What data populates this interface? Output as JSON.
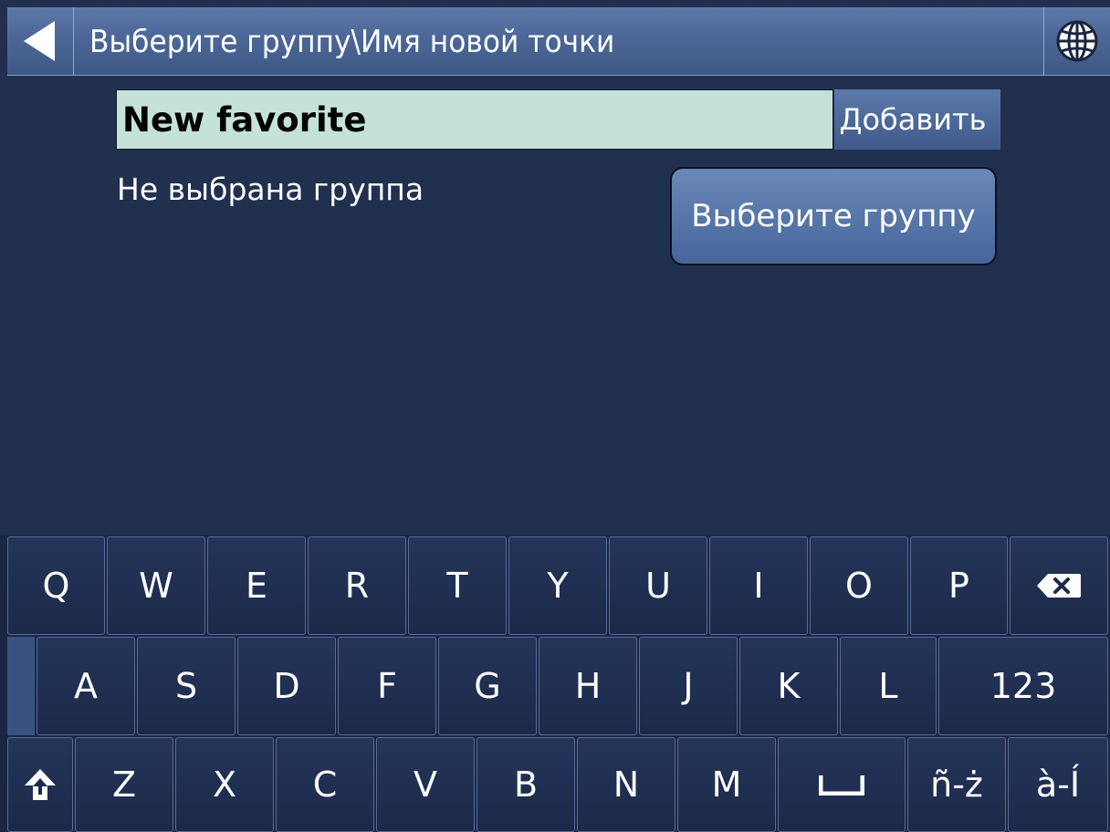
{
  "header": {
    "title": "Выберите группу\\Имя новой точки",
    "back_icon": "back-arrow-icon",
    "globe_icon": "globe-icon"
  },
  "form": {
    "name_value": "New favorite",
    "add_label": "Добавить",
    "group_status": "Не выбрана группа",
    "select_group_label": "Выберите группу"
  },
  "keyboard": {
    "row1": [
      "Q",
      "W",
      "E",
      "R",
      "T",
      "Y",
      "U",
      "I",
      "O",
      "P"
    ],
    "backspace_icon": "backspace-icon",
    "row2": [
      "A",
      "S",
      "D",
      "F",
      "G",
      "H",
      "J",
      "K",
      "L"
    ],
    "numbers_label": "123",
    "shift_icon": "shift-icon",
    "row3": [
      "Z",
      "X",
      "C",
      "V",
      "B",
      "N",
      "M"
    ],
    "space_icon": "space-icon",
    "accent1_label": "ñ-ż",
    "accent2_label": "à-Í"
  },
  "colors": {
    "background": "#22304f",
    "header": "#4c6797",
    "input_bg": "#c4e2da",
    "button": "#5b79ab"
  }
}
